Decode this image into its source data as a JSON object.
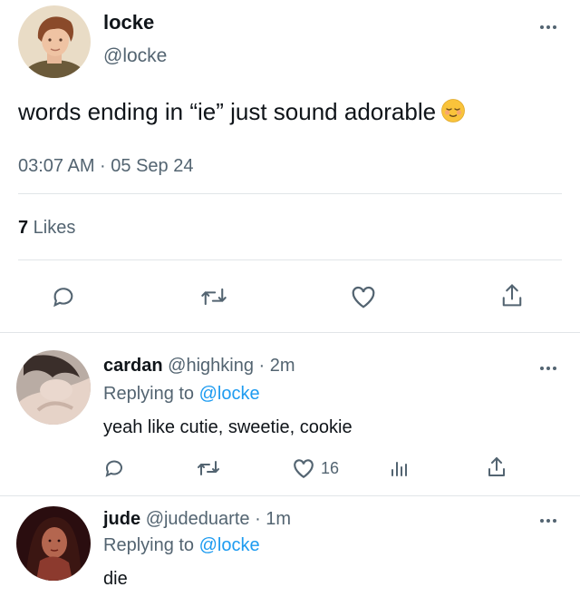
{
  "main_tweet": {
    "author_name": "locke",
    "author_handle": "@locke",
    "text": "words ending in “ie” just sound adorable",
    "emoji_icon": "relieved-face-icon",
    "timestamp": "03:07 AM · 05 Sep 24",
    "likes_count": "7",
    "likes_label": " Likes",
    "actions": [
      "reply-icon",
      "retweet-icon",
      "like-icon",
      "share-icon"
    ]
  },
  "replies": [
    {
      "name": "cardan",
      "handle": "@highking",
      "time": " · 2m",
      "replying_prefix": "Replying to ",
      "replying_to": "@locke",
      "text": "yeah like cutie, sweetie, cookie",
      "like_count": "16",
      "actions": [
        "reply-icon",
        "retweet-icon",
        "like-icon",
        "analytics-icon",
        "share-icon"
      ]
    },
    {
      "name": "jude",
      "handle": "@judeduarte",
      "time": " · 1m",
      "replying_prefix": "Replying to ",
      "replying_to": "@locke",
      "text": "die"
    }
  ],
  "colors": {
    "text": "#0f1419",
    "secondary": "#536471",
    "link": "#1d9bf0",
    "divider": "#e1e5e8"
  }
}
